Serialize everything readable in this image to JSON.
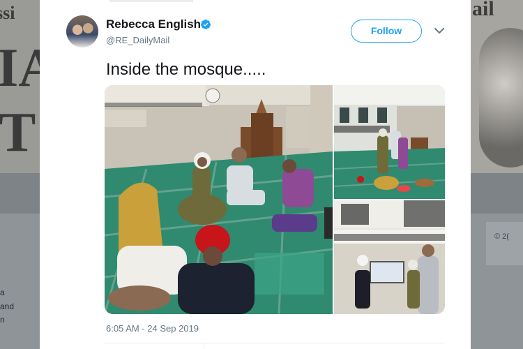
{
  "tweet": {
    "author_name": "Rebecca English",
    "author_handle": "@RE_DailyMail",
    "verified": true,
    "follow_label": "Follow",
    "text": "Inside the mosque.....",
    "timestamp": "6:05 AM - 24 Sep 2019",
    "media": [
      {
        "name": "photo-main"
      },
      {
        "name": "photo-top-right"
      },
      {
        "name": "photo-bottom-right"
      }
    ]
  },
  "background": {
    "left_snippet_1": "and",
    "left_snippet_2": "n",
    "right_snippet": "© 2("
  },
  "colors": {
    "accent": "#1da1f2",
    "text_primary": "#14171a",
    "text_secondary": "#657786"
  },
  "icons": [
    "verified-badge-icon",
    "chevron-down-icon"
  ]
}
